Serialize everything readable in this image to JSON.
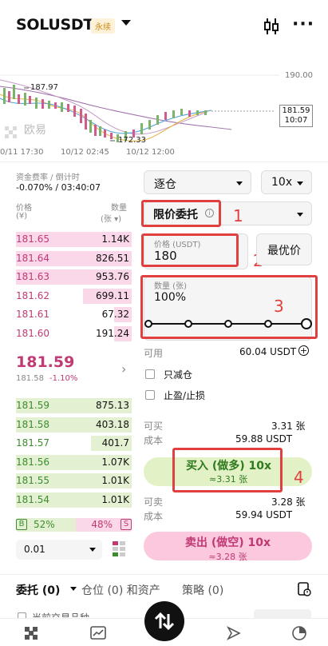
{
  "header": {
    "symbol": "SOLUSDT",
    "badge": "永续"
  },
  "chart": {
    "price_high_label": "187.97",
    "price_low_label": "172.33",
    "axis_right_top": "190.00",
    "current_price": "181.59",
    "countdown": "10:07",
    "watermark": "欧易",
    "x_labels": [
      "0/11 17:30",
      "10/12 02:45",
      "10/12 12:00"
    ]
  },
  "funding": {
    "label": "资金费率 / 倒计时",
    "value": "-0.070% / 03:40:07"
  },
  "orderbook": {
    "price_header": "价格",
    "price_unit": "(¥)",
    "qty_header": "数量",
    "qty_unit": "(张 ▾)",
    "asks": [
      {
        "price": "181.65",
        "qty": "1.14K",
        "depth": 1.0
      },
      {
        "price": "181.64",
        "qty": "826.51",
        "depth": 1.0
      },
      {
        "price": "181.63",
        "qty": "953.76",
        "depth": 1.0
      },
      {
        "price": "181.62",
        "qty": "699.11",
        "depth": 0.42
      },
      {
        "price": "181.61",
        "qty": "67.32",
        "depth": 0.15
      },
      {
        "price": "181.60",
        "qty": "191.24",
        "depth": 0.15
      }
    ],
    "last_price": "181.59",
    "last_sub": "181.58",
    "last_change": "-1.10%",
    "bids": [
      {
        "price": "181.59",
        "qty": "875.13",
        "depth": 1.0
      },
      {
        "price": "181.58",
        "qty": "403.18",
        "depth": 1.0
      },
      {
        "price": "181.57",
        "qty": "401.7",
        "depth": 0.35
      },
      {
        "price": "181.56",
        "qty": "1.07K",
        "depth": 1.0
      },
      {
        "price": "181.55",
        "qty": "1.01K",
        "depth": 1.0
      },
      {
        "price": "181.54",
        "qty": "1.01K",
        "depth": 1.0
      }
    ],
    "buy_tag": "B",
    "buy_pct": "52%",
    "sell_pct": "48%",
    "sell_tag": "S",
    "buy_ratio": 0.52,
    "tick_size": "0.01"
  },
  "form": {
    "margin_mode": "逐仓",
    "leverage": "10x",
    "order_type": "限价委托",
    "price_label": "价格 (USDT)",
    "price_value": "180",
    "best_price": "最优价",
    "qty_label": "数量 (张)",
    "qty_value": "100%",
    "available_label": "可用",
    "available_value": "60.04 USDT",
    "reduce_only": "只减仓",
    "tp_sl": "止盈/止损",
    "can_buy_label": "可买",
    "can_buy_value": "3.31 张",
    "cost_label": "成本",
    "cost_buy_value": "59.88 USDT",
    "buy_button": "买入 (做多) 10x",
    "buy_sub": "≈3.31 张",
    "can_sell_label": "可卖",
    "can_sell_value": "3.28 张",
    "cost_sell_value": "59.94 USDT",
    "sell_button": "卖出 (做空) 10x",
    "sell_sub": "≈3.28 张"
  },
  "annotations": [
    "1",
    "2",
    "3",
    "4"
  ],
  "tabs": {
    "orders": "委托 (0)",
    "positions": "仓位 (0) 和资产",
    "strategy": "策略 (0)"
  },
  "footer": {
    "partial_text": "当前交易品种"
  },
  "colors": {
    "ask": "#c03a74",
    "bid": "#3d8c2f",
    "annotation": "#e0403f"
  }
}
